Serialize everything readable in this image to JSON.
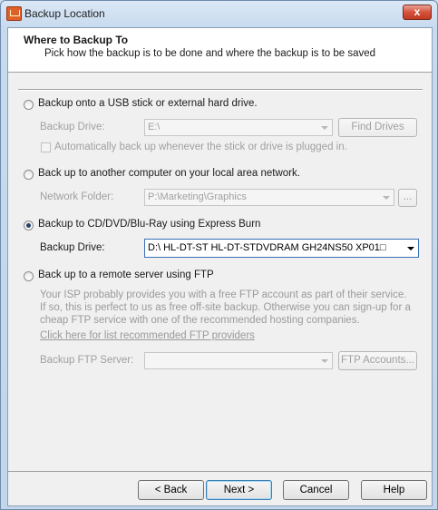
{
  "window": {
    "title": "Backup Location",
    "close_label": "x"
  },
  "header": {
    "title": "Where to Backup To",
    "subtitle": "Pick how the backup is to be done and where the backup is to be saved"
  },
  "options": {
    "usb": {
      "label": "Backup onto a USB stick or external hard drive.",
      "selected": false,
      "drive_label": "Backup Drive:",
      "drive_value": "E:\\",
      "find_drives_label": "Find Drives",
      "auto_backup_label": "Automatically back up whenever the stick or drive is plugged in."
    },
    "network": {
      "label": "Back up to another computer on your local area network.",
      "selected": false,
      "folder_label": "Network Folder:",
      "folder_value": "P:\\Marketing\\Graphics",
      "browse_label": "..."
    },
    "cd": {
      "label": "Backup to CD/DVD/Blu-Ray using Express Burn",
      "selected": true,
      "drive_label": "Backup Drive:",
      "drive_value": "D:\\ HL-DT-ST HL-DT-STDVDRAM GH24NS50 XP01□"
    },
    "ftp": {
      "label": "Back up to a remote server using FTP",
      "selected": false,
      "description": "Your ISP probably provides you with a free FTP account as part of their service. If so, this is perfect to us as free off-site backup. Otherwise you can sign-up for a cheap FTP service with one of the recommended hosting companies.",
      "link_label": "Click here for list recommended FTP providers",
      "server_label": "Backup FTP Server:",
      "server_value": "",
      "accounts_label": "FTP Accounts..."
    }
  },
  "footer": {
    "back_label": "< Back",
    "next_label": "Next >",
    "cancel_label": "Cancel",
    "help_label": "Help"
  }
}
